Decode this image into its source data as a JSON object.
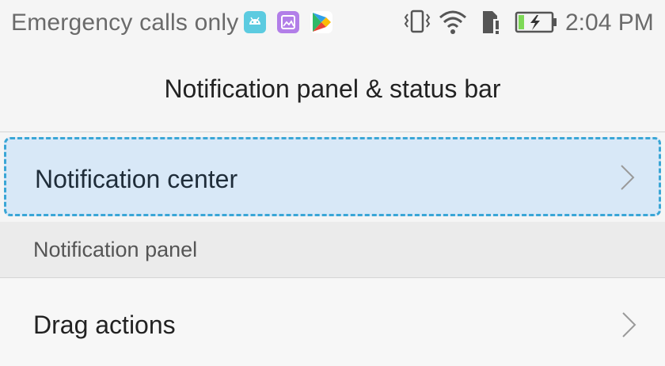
{
  "status_bar": {
    "carrier": "Emergency calls only",
    "time": "2:04 PM",
    "notification_icons": [
      "android-icon",
      "gallery-icon",
      "play-store-icon"
    ],
    "system_icons": [
      "vibrate-icon",
      "wifi-icon",
      "sim-alert-icon",
      "battery-charging-icon"
    ]
  },
  "header": {
    "title": "Notification panel & status bar"
  },
  "list": {
    "notification_center": "Notification center",
    "section_notification_panel": "Notification panel",
    "drag_actions": "Drag actions"
  },
  "colors": {
    "highlight_bg": "#d8e8f7",
    "highlight_border": "#3aa6d6",
    "section_bg": "#ebebeb",
    "page_bg": "#f5f5f5"
  }
}
